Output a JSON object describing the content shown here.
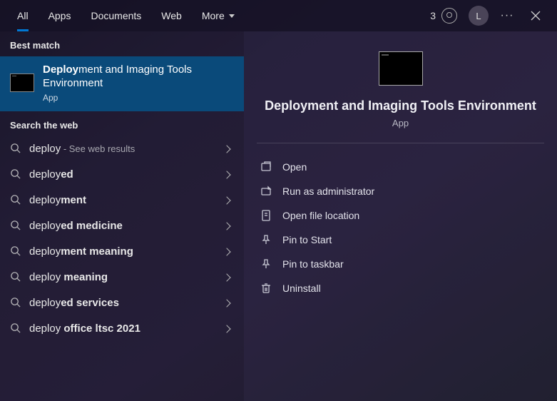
{
  "tabs": {
    "all": "All",
    "apps": "Apps",
    "documents": "Documents",
    "web": "Web",
    "more": "More"
  },
  "header": {
    "reward_count": "3",
    "avatar_letter": "L"
  },
  "left": {
    "best_match_header": "Best match",
    "best_match": {
      "title_prefix": "Deploy",
      "title_rest": "ment and Imaging Tools Environment",
      "subtitle": "App"
    },
    "web_header": "Search the web",
    "web_items": [
      {
        "prefix": "deploy",
        "bold": "",
        "hint": " - See web results"
      },
      {
        "prefix": "deploy",
        "bold": "ed",
        "hint": ""
      },
      {
        "prefix": "deploy",
        "bold": "ment",
        "hint": ""
      },
      {
        "prefix": "deploy",
        "bold": "ed medicine",
        "hint": ""
      },
      {
        "prefix": "deploy",
        "bold": "ment meaning",
        "hint": ""
      },
      {
        "prefix": "deploy ",
        "bold": "meaning",
        "hint": ""
      },
      {
        "prefix": "deploy",
        "bold": "ed services",
        "hint": ""
      },
      {
        "prefix": "deploy ",
        "bold": "office ltsc 2021",
        "hint": ""
      }
    ]
  },
  "right": {
    "title": "Deployment and Imaging Tools Environment",
    "subtitle": "App",
    "actions": {
      "open": "Open",
      "run_admin": "Run as administrator",
      "open_location": "Open file location",
      "pin_start": "Pin to Start",
      "pin_taskbar": "Pin to taskbar",
      "uninstall": "Uninstall"
    }
  }
}
